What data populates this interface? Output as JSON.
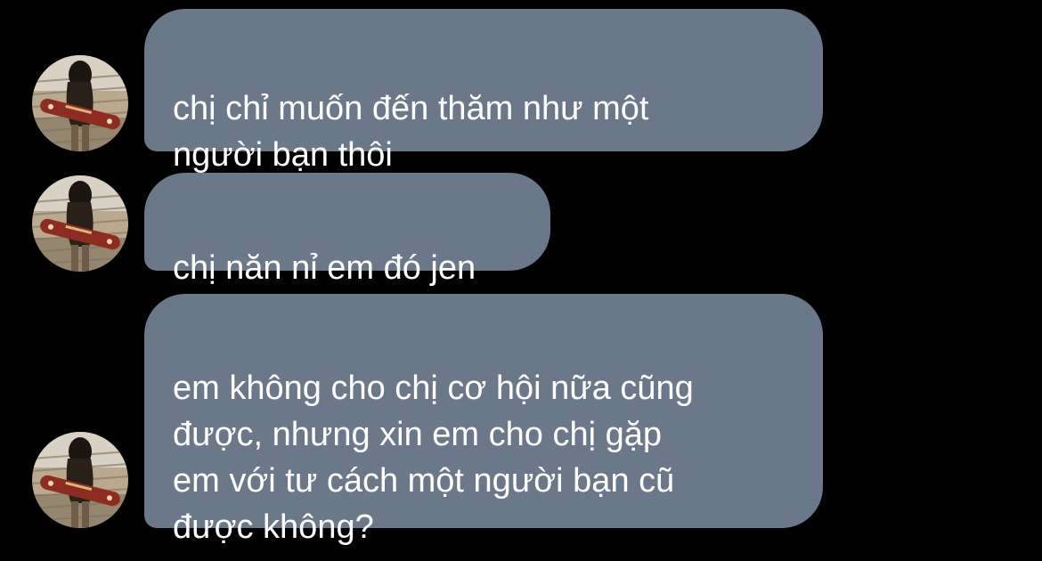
{
  "conversation": {
    "messages": [
      {
        "text": "chị chỉ muốn đến thăm như một\nngười bạn thôi"
      },
      {
        "text": "chị năn nỉ em đó jen"
      },
      {
        "text": "em không cho chị cơ hội nữa cũng\nđược, nhưng xin em cho chị gặp\nem với tư cách một người bạn cũ\nđược không?"
      }
    ]
  },
  "colors": {
    "background": "#000000",
    "bubble": "#6b7889",
    "text": "#ffffff"
  },
  "icons": {
    "avatar": "profile-photo-avatar"
  }
}
